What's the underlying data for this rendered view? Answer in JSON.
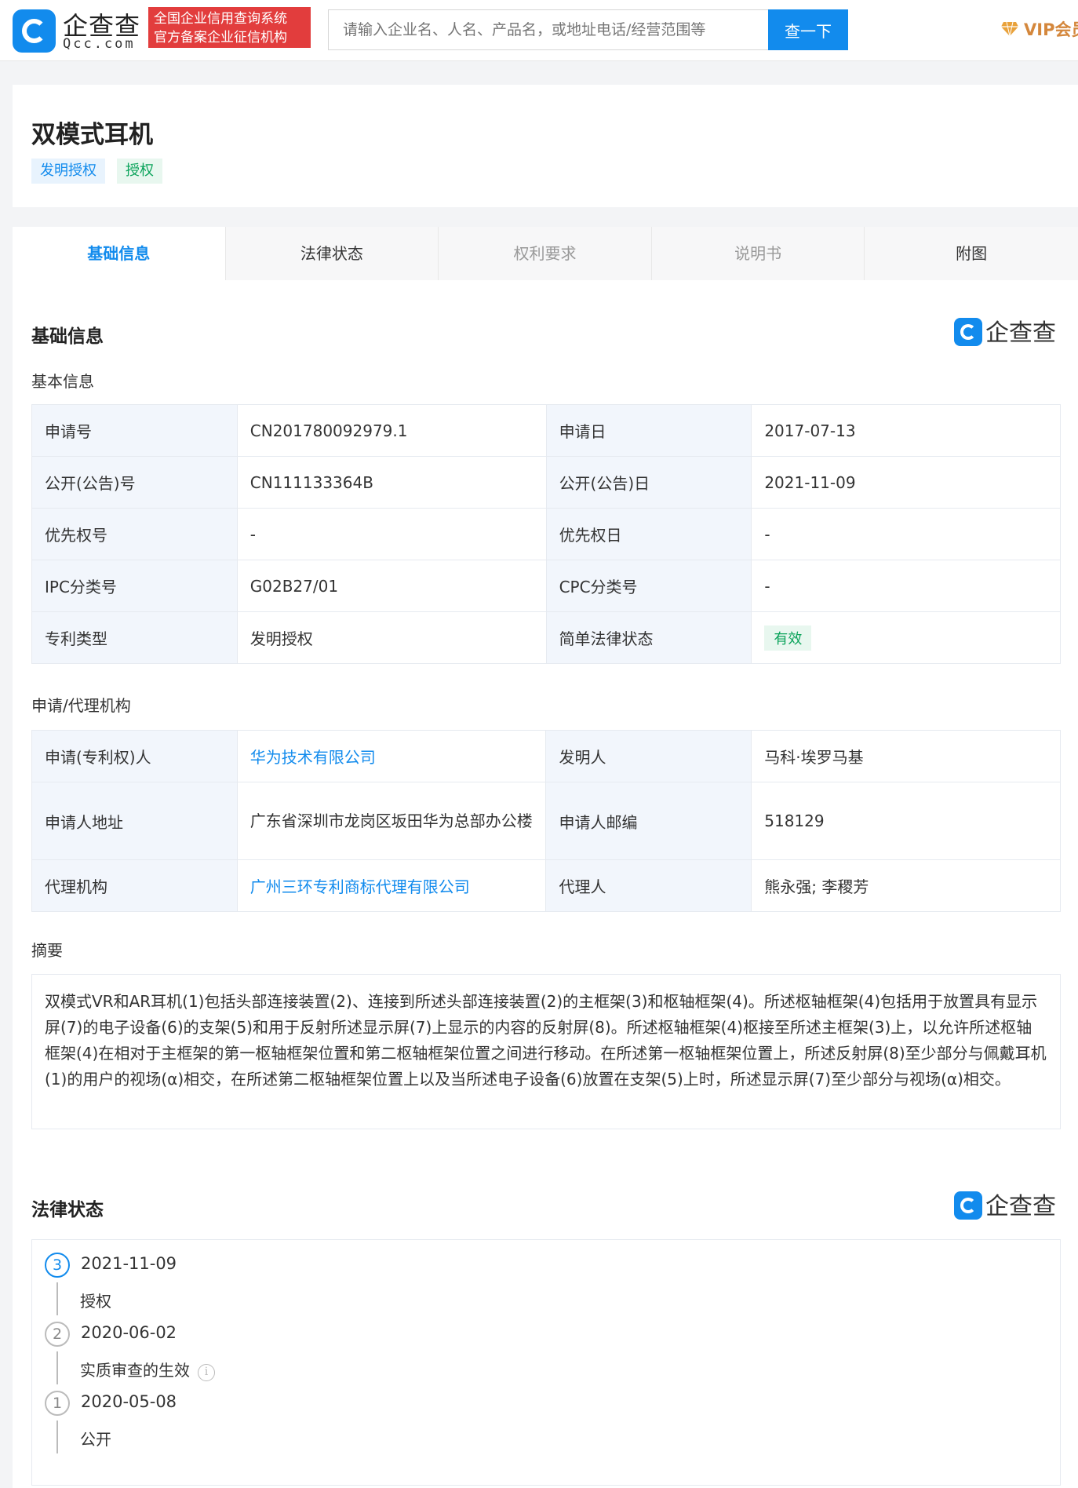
{
  "header": {
    "brand_cn": "企查查",
    "brand_en": "Qcc.com",
    "cert_line1": "全国企业信用查询系统",
    "cert_line2": "官方备案企业征信机构",
    "search_placeholder": "请输入企业名、人名、产品名，或地址电话/经营范围等",
    "search_button": "查一下",
    "vip_label": "VIP会员"
  },
  "title_card": {
    "title": "双模式耳机",
    "tags": [
      "发明授权",
      "授权"
    ]
  },
  "tabs": [
    {
      "label": "基础信息"
    },
    {
      "label": "法律状态"
    },
    {
      "label": "权利要求"
    },
    {
      "label": "说明书"
    },
    {
      "label": "附图"
    }
  ],
  "basic": {
    "section_title": "基础信息",
    "watermark": "企查查",
    "sub_basic": "基本信息",
    "rows": [
      {
        "l1": "申请号",
        "v1": "CN201780092979.1",
        "l2": "申请日",
        "v2": "2017-07-13"
      },
      {
        "l1": "公开(公告)号",
        "v1": "CN111133364B",
        "l2": "公开(公告)日",
        "v2": "2021-11-09"
      },
      {
        "l1": "优先权号",
        "v1": "-",
        "l2": "优先权日",
        "v2": "-"
      },
      {
        "l1": "IPC分类号",
        "v1": "G02B27/01",
        "l2": "CPC分类号",
        "v2": "-"
      },
      {
        "l1": "专利类型",
        "v1": "发明授权",
        "l2": "简单法律状态",
        "v2": "有效"
      }
    ],
    "sub_agency": "申请/代理机构",
    "agency_rows": [
      {
        "l1": "申请(专利权)人",
        "v1": "华为技术有限公司",
        "l2": "发明人",
        "v2": "马科·埃罗马基"
      },
      {
        "l1": "申请人地址",
        "v1": "广东省深圳市龙岗区坂田华为总部办公楼",
        "l2": "申请人邮编",
        "v2": "518129"
      },
      {
        "l1": "代理机构",
        "v1": "广州三环专利商标代理有限公司",
        "l2": "代理人",
        "v2": "熊永强; 李稷芳"
      }
    ],
    "sub_abstract": "摘要",
    "abstract": "双模式VR和AR耳机(1)包括头部连接装置(2)、连接到所述头部连接装置(2)的主框架(3)和枢轴框架(4)。所述枢轴框架(4)包括用于放置具有显示屏(7)的电子设备(6)的支架(5)和用于反射所述显示屏(7)上显示的内容的反射屏(8)。所述枢轴框架(4)枢接至所述主框架(3)上，以允许所述枢轴框架(4)在相对于主框架的第一枢轴框架位置和第二枢轴框架位置之间进行移动。在所述第一枢轴框架位置上，所述反射屏(8)至少部分与佩戴耳机(1)的用户的视场(α)相交，在所述第二枢轴框架位置上以及当所述电子设备(6)放置在支架(5)上时，所述显示屏(7)至少部分与视场(α)相交。"
  },
  "legal": {
    "section_title": "法律状态",
    "watermark": "企查查",
    "events": [
      {
        "num": "3",
        "date": "2021-11-09",
        "event": "授权"
      },
      {
        "num": "2",
        "date": "2020-06-02",
        "event": "实质审查的生效"
      },
      {
        "num": "1",
        "date": "2020-05-08",
        "event": "公开"
      }
    ]
  }
}
